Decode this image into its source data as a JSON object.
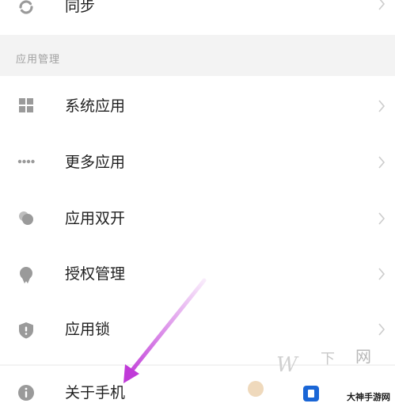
{
  "sync": {
    "label": "同步",
    "icon": "sync-icon"
  },
  "app_management": {
    "header": "应用管理",
    "items": [
      {
        "label": "系统应用",
        "icon": "grid-icon"
      },
      {
        "label": "更多应用",
        "icon": "more-dots-icon"
      },
      {
        "label": "应用双开",
        "icon": "dual-app-icon"
      },
      {
        "label": "授权管理",
        "icon": "badge-icon"
      },
      {
        "label": "应用锁",
        "icon": "shield-icon"
      }
    ]
  },
  "about": {
    "label": "关于手机",
    "icon": "info-icon"
  },
  "watermark": {
    "text": "大神手游网"
  },
  "colors": {
    "background": "#f3f3f3",
    "card": "#ffffff",
    "icon": "#9a9a9a",
    "chevron": "#cccccc",
    "arrow": "#c03ad8"
  }
}
